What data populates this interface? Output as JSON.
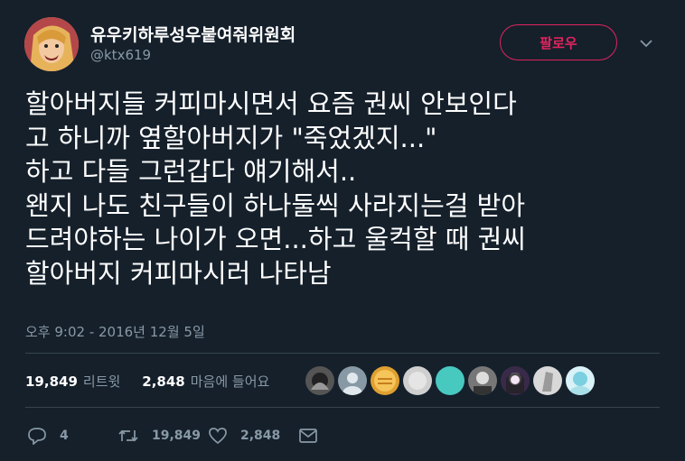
{
  "user": {
    "display_name": "유우키하루성우붙여줘위원회",
    "handle": "@ktx619"
  },
  "follow_label": "팔로우",
  "tweet": {
    "text": "할아버지들 커피마시면서 요즘 권씨 안보인다\n고 하니까 옆할아버지가 \"죽었겠지...\"\n하고 다들 그런갑다 얘기해서..\n왠지 나도 친구들이 하나둘씩 사라지는걸 받아\n드려야하는 나이가 오면...하고 울컥할 때 권씨\n할아버지 커피마시러 나타남",
    "timestamp": "오후 9:02 - 2016년 12월 5일"
  },
  "stats": {
    "retweets_count": "19,849",
    "retweets_label": "리트윗",
    "likes_count": "2,848",
    "likes_label": "마음에 들어요"
  },
  "actions": {
    "reply_count": "4",
    "retweet_count": "19,849",
    "like_count": "2,848"
  },
  "colors": {
    "background": "#15202b",
    "accent": "#e0245e",
    "muted": "#8899a6"
  }
}
